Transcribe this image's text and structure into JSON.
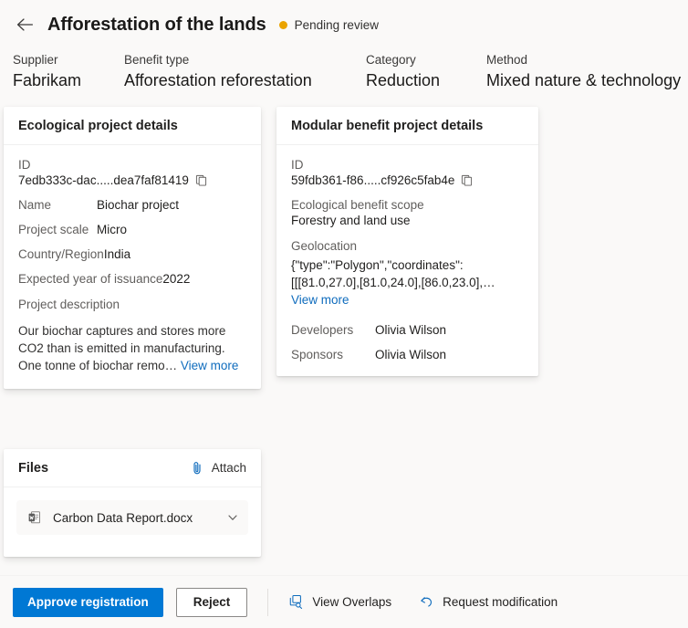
{
  "header": {
    "back_icon": "arrow-left-icon",
    "title": "Afforestation of the lands",
    "status": "Pending review",
    "status_color": "#eaa300"
  },
  "meta": [
    {
      "label": "Supplier",
      "value": "Fabrikam"
    },
    {
      "label": "Benefit type",
      "value": "Afforestation reforestation"
    },
    {
      "label": "Category",
      "value": "Reduction"
    },
    {
      "label": "Method",
      "value": "Mixed nature & technology"
    }
  ],
  "ecological_card": {
    "title": "Ecological project details",
    "id_label": "ID",
    "id_value": "7edb333c-dac.....dea7faf81419",
    "copy_icon": "copy-icon",
    "fields": [
      {
        "label": "Name",
        "value": "Biochar project"
      },
      {
        "label": "Project scale",
        "value": "Micro"
      },
      {
        "label": "Country/Region",
        "value": "India"
      },
      {
        "label": "Expected year of issuance",
        "value": "2022"
      }
    ],
    "description_label": "Project description",
    "description": "Our biochar captures and stores more CO2 than is emitted in manufacturing. One tonne of biochar remo…",
    "view_more": "View more"
  },
  "modular_card": {
    "title": "Modular benefit project details",
    "id_label": "ID",
    "id_value": "59fdb361-f86.....cf926c5fab4e",
    "copy_icon": "copy-icon",
    "scope_label": "Ecological benefit scope",
    "scope_value": "Forestry and land use",
    "geolocation_label": "Geolocation",
    "geolocation_value": "{\"type\":\"Polygon\",\"coordinates\": [[[81.0,27.0],[81.0,24.0],[86.0,23.0],…",
    "view_more": "View more",
    "people": [
      {
        "label": "Developers",
        "value": "Olivia Wilson"
      },
      {
        "label": "Sponsors",
        "value": "Olivia Wilson"
      }
    ]
  },
  "files_card": {
    "title": "Files",
    "attach_label": "Attach",
    "attach_icon": "paperclip-icon",
    "file_name": "Carbon Data Report.docx",
    "file_icon": "word-document-icon",
    "chevron_icon": "chevron-down-icon"
  },
  "footer": {
    "approve_label": "Approve registration",
    "reject_label": "Reject",
    "view_overlaps_label": "View Overlaps",
    "view_overlaps_icon": "overlap-search-icon",
    "request_modification_label": "Request modification",
    "request_modification_icon": "undo-arrow-icon",
    "primary_color": "#0078d4",
    "link_color": "#0f6cbd"
  }
}
